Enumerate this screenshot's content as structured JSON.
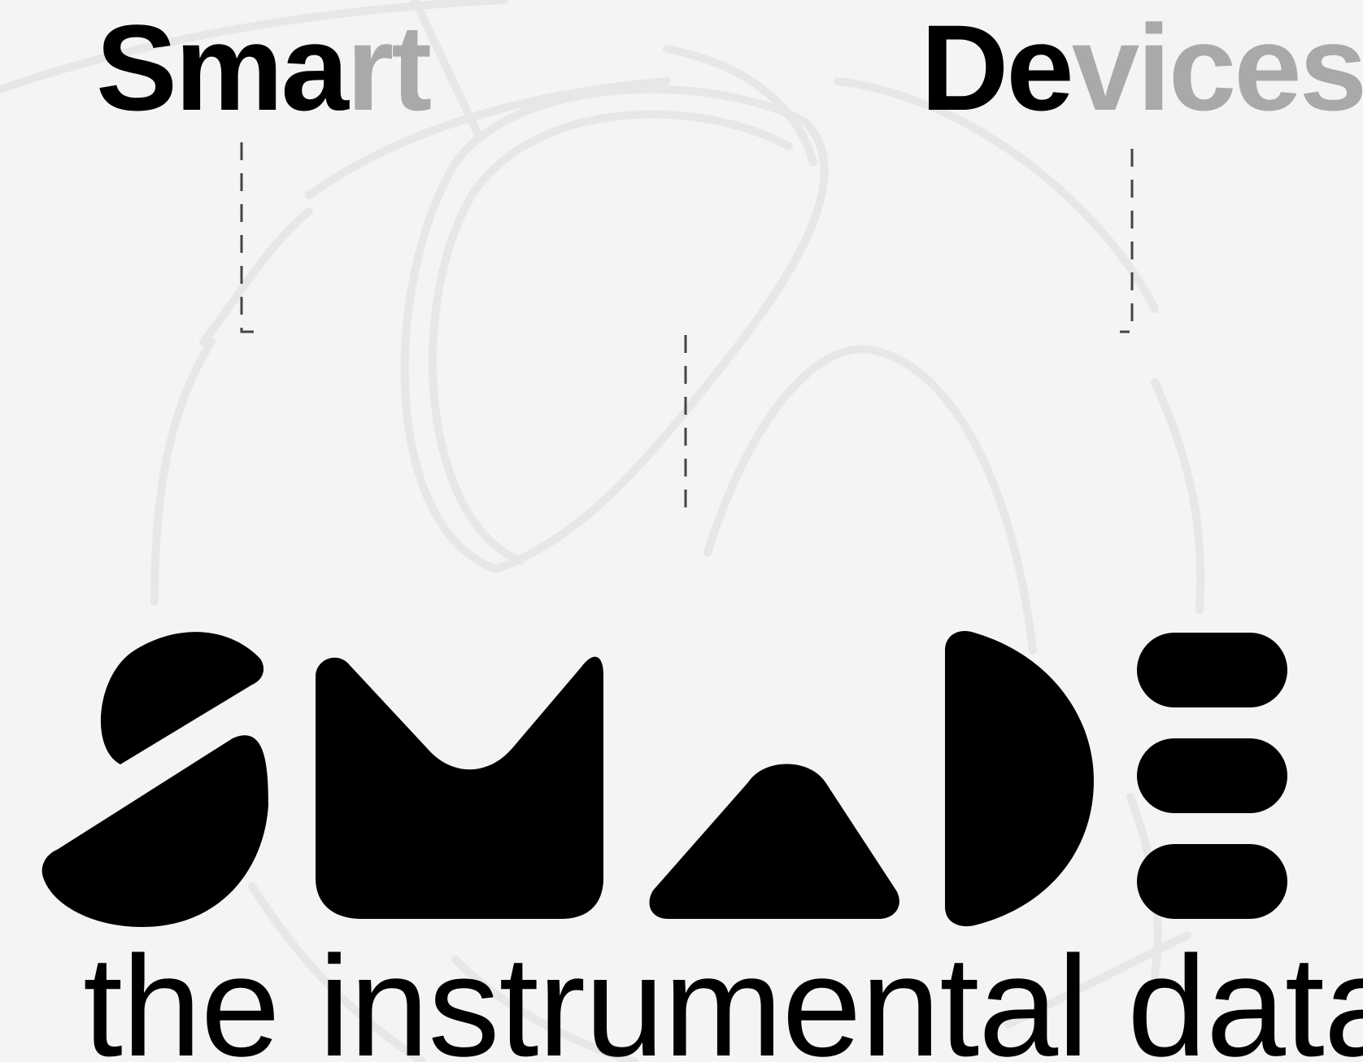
{
  "header": {
    "smart": {
      "dark": "Sma",
      "light": "rt"
    },
    "devices": {
      "dark": "De",
      "light": "vices"
    }
  },
  "logo": {
    "tagline": "the instrumental data",
    "letters": [
      "S",
      "M",
      "A",
      "D",
      "E"
    ]
  },
  "colors": {
    "background": "#f4f4f4",
    "ink": "#000000",
    "muted_text": "#a9a9a9",
    "sketch": "#e6e6e6",
    "guide": "#444444"
  }
}
